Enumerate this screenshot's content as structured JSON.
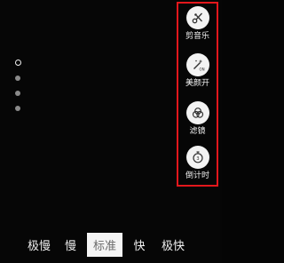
{
  "tools": [
    {
      "label": "剪音乐",
      "icon": "scissors-icon"
    },
    {
      "label": "美颜开",
      "icon": "beauty-wand-icon"
    },
    {
      "label": "滤镜",
      "icon": "filter-circles-icon"
    },
    {
      "label": "倒计时",
      "icon": "countdown-timer-icon"
    }
  ],
  "speed": {
    "options": [
      "极慢",
      "慢",
      "标准",
      "快",
      "极快"
    ],
    "selected": "标准"
  },
  "page_indicator": {
    "total": 4,
    "active_index": 0
  },
  "colors": {
    "highlight_border": "#e3171c",
    "background": "#060606",
    "tool_circle": "#f3f3f3",
    "selected_speed_bg": "#f4f4f4"
  }
}
